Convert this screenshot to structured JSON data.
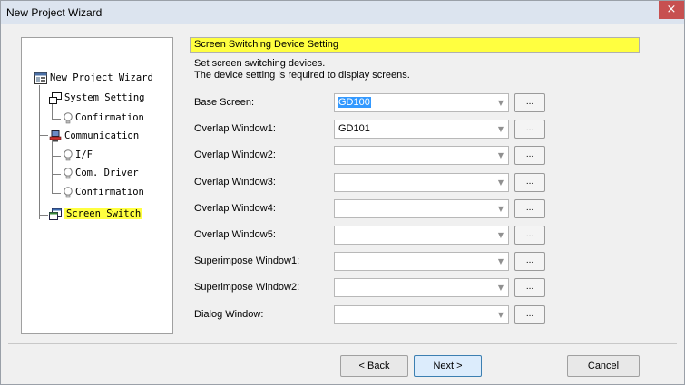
{
  "window": {
    "title": "New Project Wizard",
    "close_label": "×"
  },
  "tree": {
    "root": "New Project Wizard",
    "system_setting": "System Setting",
    "sys_confirmation": "Confirmation",
    "communication": "Communication",
    "if": "I/F",
    "com_driver": "Com. Driver",
    "com_confirmation": "Confirmation",
    "screen_switch": "Screen Switch"
  },
  "section": {
    "title": "Screen Switching Device Setting",
    "desc_line1": "Set screen switching devices.",
    "desc_line2": "The device setting is required to display screens."
  },
  "fields": [
    {
      "label": "Base Screen:",
      "value": "GD100",
      "selected": true
    },
    {
      "label": "Overlap Window1:",
      "value": "GD101"
    },
    {
      "label": "Overlap Window2:",
      "value": ""
    },
    {
      "label": "Overlap Window3:",
      "value": ""
    },
    {
      "label": "Overlap Window4:",
      "value": ""
    },
    {
      "label": "Overlap Window5:",
      "value": ""
    },
    {
      "label": "Superimpose Window1:",
      "value": ""
    },
    {
      "label": "Superimpose Window2:",
      "value": ""
    },
    {
      "label": "Dialog Window:",
      "value": ""
    }
  ],
  "browse_label": "...",
  "combo_arrow": "▼",
  "buttons": {
    "back": "< Back",
    "next": "Next >",
    "cancel": "Cancel"
  }
}
